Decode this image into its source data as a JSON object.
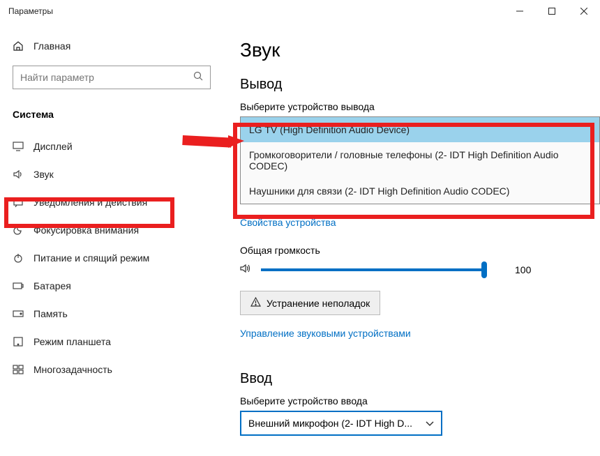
{
  "titlebar": {
    "title": "Параметры"
  },
  "sidebar": {
    "home_label": "Главная",
    "search_placeholder": "Найти параметр",
    "system_header": "Система",
    "items": [
      {
        "label": "Дисплей"
      },
      {
        "label": "Звук"
      },
      {
        "label": "Уведомления и действия"
      },
      {
        "label": "Фокусировка внимания"
      },
      {
        "label": "Питание и спящий режим"
      },
      {
        "label": "Батарея"
      },
      {
        "label": "Память"
      },
      {
        "label": "Режим планшета"
      },
      {
        "label": "Многозадачность"
      }
    ]
  },
  "main": {
    "page_title": "Звук",
    "output_header": "Вывод",
    "output_select_label": "Выберите устройство вывода",
    "output_options": [
      "LG TV (High Definition Audio Device)",
      "Громкоговорители / головные телефоны (2- IDT High Definition Audio CODEC)",
      "Наушники для связи (2- IDT High Definition Audio CODEC)"
    ],
    "device_properties_link": "Свойства устройства",
    "master_volume_label": "Общая громкость",
    "master_volume_value": "100",
    "troubleshoot_label": "Устранение неполадок",
    "manage_devices_link": "Управление звуковыми устройствами",
    "input_header": "Ввод",
    "input_select_label": "Выберите устройство ввода",
    "input_selected": "Внешний микрофон (2- IDT High D..."
  }
}
